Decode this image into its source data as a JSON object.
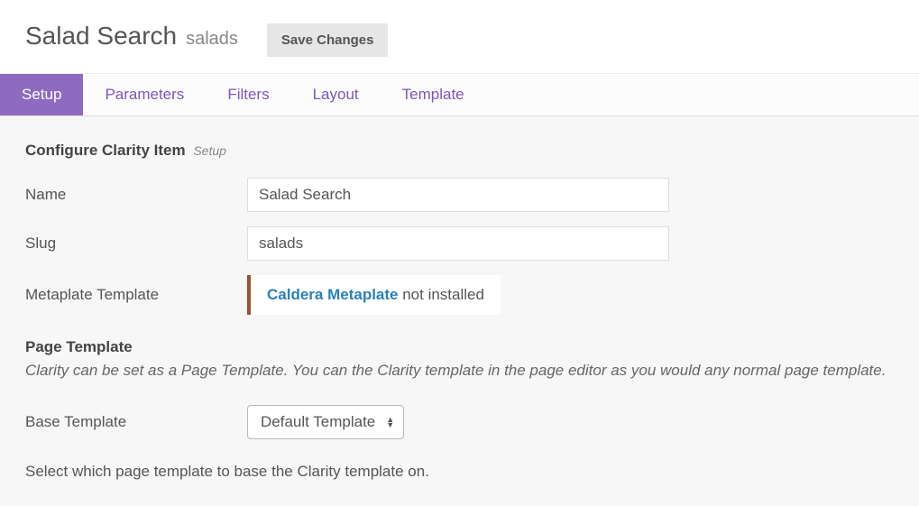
{
  "header": {
    "title": "Salad Search",
    "slug": "salads",
    "save_label": "Save Changes"
  },
  "tabs": {
    "setup": "Setup",
    "parameters": "Parameters",
    "filters": "Filters",
    "layout": "Layout",
    "template": "Template"
  },
  "section": {
    "heading": "Configure Clarity Item",
    "sub": "Setup"
  },
  "form": {
    "name_label": "Name",
    "name_value": "Salad Search",
    "slug_label": "Slug",
    "slug_value": "salads",
    "metaplate_label": "Metaplate Template",
    "metaplate_link": "Caldera Metaplate",
    "metaplate_suffix": " not installed"
  },
  "page_template": {
    "heading": "Page Template",
    "desc": "Clarity can be set as a Page Template. You can the Clarity template in the page editor as you would any normal page template.",
    "base_label": "Base Template",
    "selected": "Default Template",
    "help": "Select which page template to base the Clarity template on."
  }
}
